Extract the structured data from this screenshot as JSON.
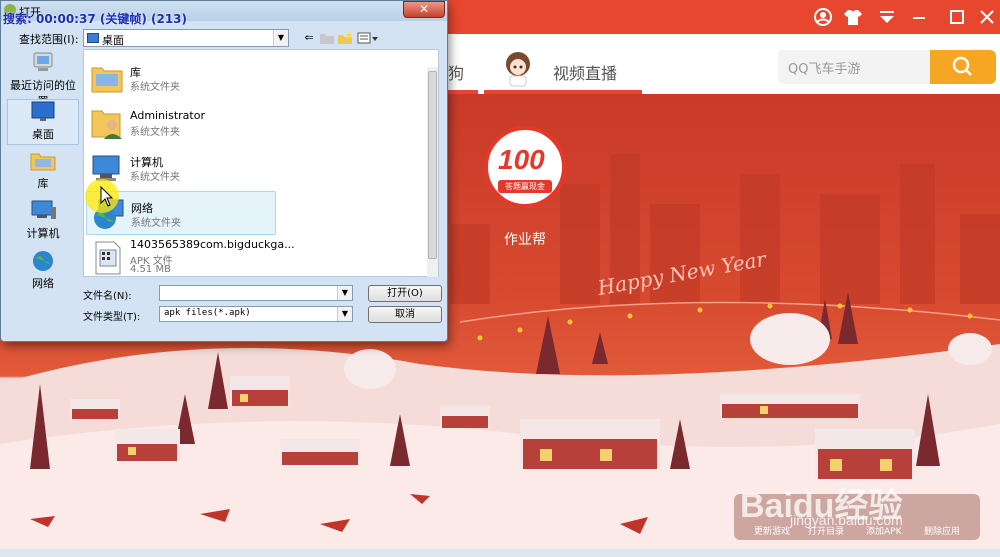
{
  "app": {
    "tabs": [
      {
        "label": "狗"
      },
      {
        "label": "视频直播"
      }
    ],
    "search": {
      "placeholder": "QQ飞车手游"
    },
    "featured_app": {
      "name": "作业帮",
      "icon_text": "100",
      "icon_subtext": "答题赢现金"
    },
    "banner_text": "Happy New Year",
    "bottom_bar": [
      {
        "label": "更新游戏"
      },
      {
        "label": "打开目录"
      },
      {
        "label": "添加APK"
      },
      {
        "label": "删除应用"
      }
    ],
    "watermark": {
      "text": "Baidu经验",
      "sub": "jingyan.baidu.com"
    },
    "colors": {
      "accent": "#e8472f",
      "search_button": "#f5a623"
    }
  },
  "overlay": {
    "recording": "搜索: 00:00:37 (关键帧) (213)"
  },
  "dialog": {
    "title": "打开",
    "close_symbol": "✕",
    "look_in": {
      "label": "查找范围(I):",
      "value": "桌面"
    },
    "places": [
      {
        "label": "最近访问的位置",
        "icon": "recent-icon"
      },
      {
        "label": "桌面",
        "icon": "desktop-icon",
        "selected": true
      },
      {
        "label": "库",
        "icon": "library-icon"
      },
      {
        "label": "计算机",
        "icon": "computer-icon"
      },
      {
        "label": "网络",
        "icon": "network-icon"
      }
    ],
    "items": [
      {
        "name": "库",
        "type": "系统文件夹",
        "icon": "library-folder-icon"
      },
      {
        "name": "Administrator",
        "type": "系统文件夹",
        "icon": "user-folder-icon"
      },
      {
        "name": "计算机",
        "type": "系统文件夹",
        "icon": "computer-icon"
      },
      {
        "name": "网络",
        "type": "系统文件夹",
        "icon": "network-icon",
        "hovered": true
      },
      {
        "name": "1403565389com.bigduckga...",
        "type": "APK 文件",
        "size": "4.51 MB",
        "icon": "apk-file-icon"
      }
    ],
    "filename": {
      "label": "文件名(N):",
      "value": ""
    },
    "filetype": {
      "label": "文件类型(T):",
      "value": "apk files(*.apk)"
    },
    "open_button": "打开(O)",
    "cancel_button": "取消"
  }
}
